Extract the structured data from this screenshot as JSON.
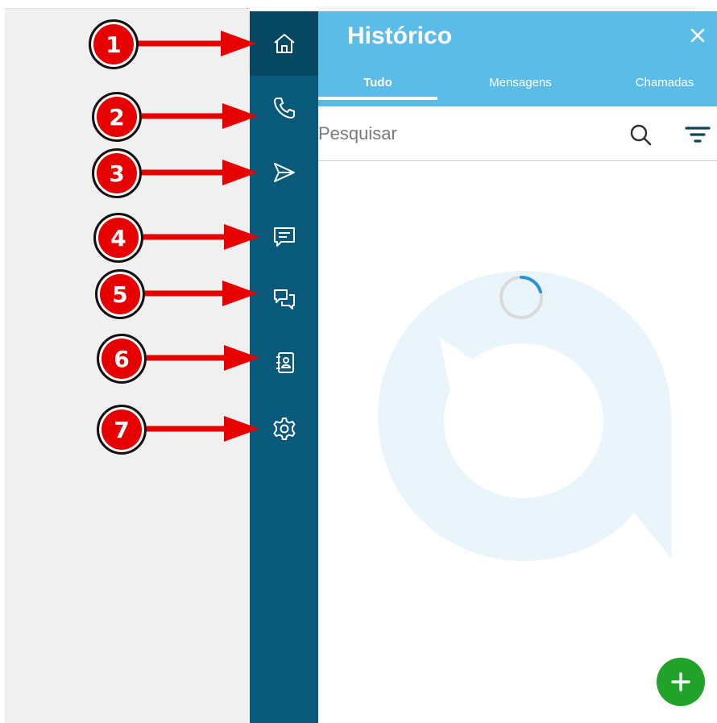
{
  "panel": {
    "title": "Histórico",
    "tabs": [
      {
        "label": "Tudo",
        "active": true
      },
      {
        "label": "Mensagens",
        "active": false
      },
      {
        "label": "Chamadas",
        "active": false
      }
    ],
    "search": {
      "placeholder": "Pesquisar",
      "value": ""
    }
  },
  "rail": {
    "items": [
      "home-icon",
      "phone-icon",
      "send-icon",
      "message-icon",
      "chat-icon",
      "contacts-icon",
      "settings-icon"
    ],
    "active": "home-icon"
  },
  "annotations": [
    "1",
    "2",
    "3",
    "4",
    "5",
    "6",
    "7"
  ],
  "colors": {
    "rail": "#08597a",
    "rail_active": "#064861",
    "header": "#5bbde7",
    "fab": "#21a32a",
    "marker": "#e60000",
    "watermark": "#eaf5fb"
  }
}
